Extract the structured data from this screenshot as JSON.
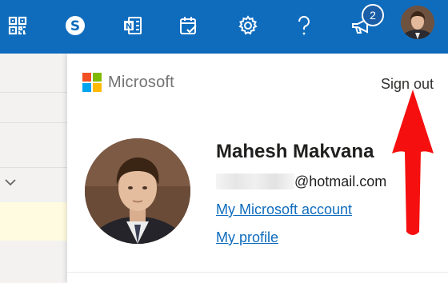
{
  "topbar": {
    "icons": [
      "qr-code-icon",
      "skype-icon",
      "onenote-icon",
      "my-day-icon",
      "settings-icon",
      "help-icon",
      "feedback-icon"
    ],
    "notification_count": "2",
    "colors": {
      "background": "#0f6cbd",
      "icon": "#ffffff"
    }
  },
  "panel": {
    "brand": "Microsoft",
    "sign_out_label": "Sign out",
    "user": {
      "name": "Mahesh Makvana",
      "email_domain": "@hotmail.com"
    },
    "links": {
      "account": "My Microsoft account",
      "profile": "My profile"
    },
    "brand_colors": [
      "#f25022",
      "#7fba00",
      "#00a4ef",
      "#ffb900"
    ],
    "link_color": "#0f6cbd"
  },
  "annotation": {
    "arrow_color": "#ff0000"
  }
}
